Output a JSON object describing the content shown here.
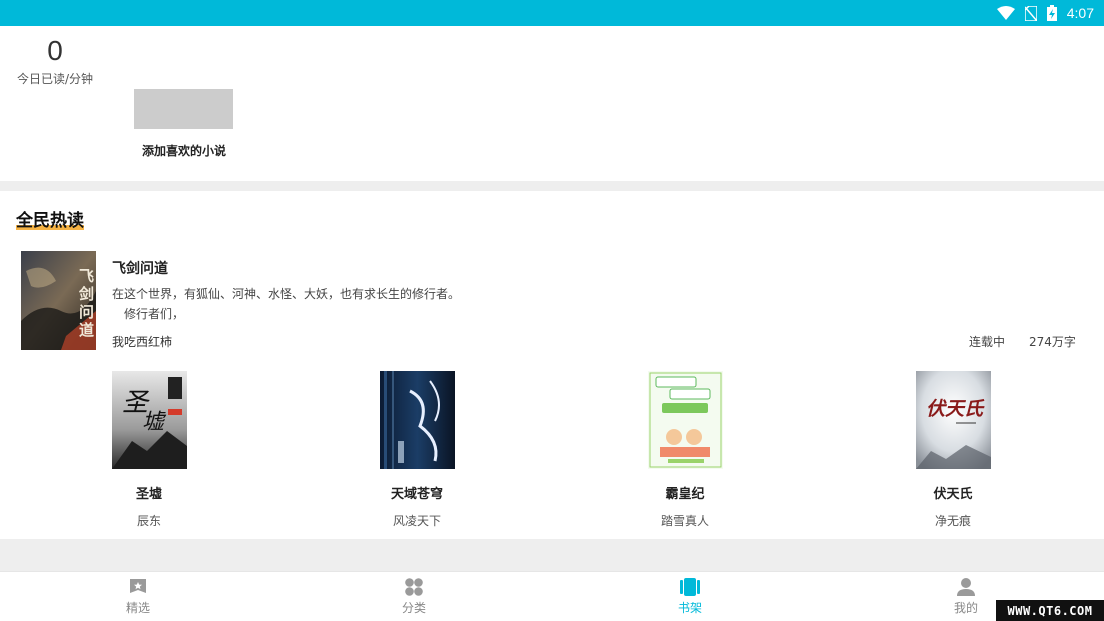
{
  "status_bar": {
    "time": "4:07",
    "icons": [
      "wifi-icon",
      "no-sim-icon",
      "battery-charging-icon"
    ],
    "background": "#00b9d9"
  },
  "reading_stats": {
    "minutes_read_today": "0",
    "label": "今日已读/分钟"
  },
  "shelf": {
    "add_label": "添加喜欢的小说"
  },
  "hot_section": {
    "title": "全民热读",
    "featured": {
      "title": "飞剑问道",
      "description_line1": "在这个世界，有狐仙、河神、水怪、大妖，也有求长生的修行者。",
      "description_line2": "修行者们，",
      "author": "我吃西红柿",
      "status": "连载中",
      "words": "274万字",
      "cover_text": "飞剑问道"
    },
    "books": [
      {
        "title": "圣墟",
        "author": "辰东"
      },
      {
        "title": "天域苍穹",
        "author": "风凌天下"
      },
      {
        "title": "霸皇纪",
        "author": "踏雪真人"
      },
      {
        "title": "伏天氏",
        "author": "净无痕"
      }
    ]
  },
  "tabs": [
    {
      "label": "精选",
      "icon": "bookmark-star-icon",
      "active": false
    },
    {
      "label": "分类",
      "icon": "category-grid-icon",
      "active": false
    },
    {
      "label": "书架",
      "icon": "bookshelf-icon",
      "active": true
    },
    {
      "label": "我的",
      "icon": "user-profile-icon",
      "active": false
    }
  ],
  "watermark": "WWW.QT6.COM",
  "colors": {
    "accent": "#00b9d9",
    "highlight": "#f5a623"
  }
}
